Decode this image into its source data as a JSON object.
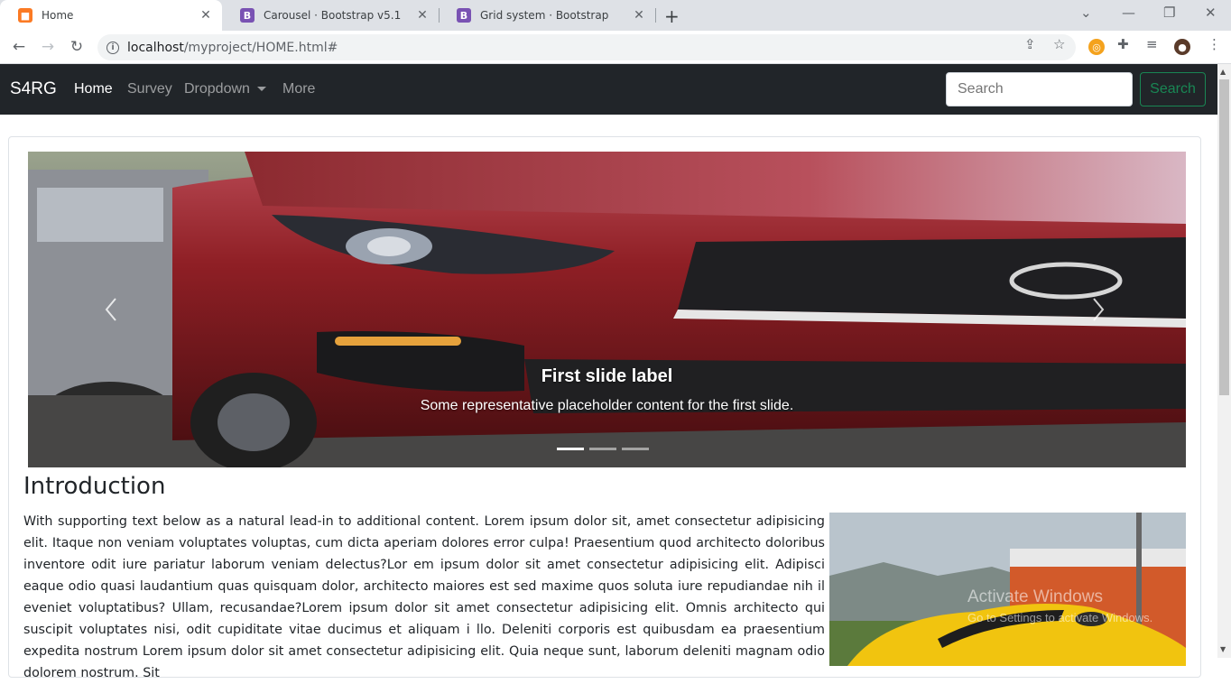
{
  "browser": {
    "tabs": [
      {
        "title": "Home",
        "favicon": "xampp-icon"
      },
      {
        "title": "Carousel · Bootstrap v5.1",
        "favicon": "bootstrap-icon"
      },
      {
        "title": "Grid system · Bootstrap",
        "favicon": "bootstrap-icon"
      }
    ],
    "url_host": "localhost",
    "url_path": "/myproject/HOME.html#"
  },
  "navbar": {
    "brand": "S4RG",
    "links": [
      "Home",
      "Survey",
      "Dropdown",
      "More"
    ],
    "search_placeholder": "Search",
    "search_button": "Search"
  },
  "carousel": {
    "slide_title": "First slide label",
    "slide_text": "Some representative placeholder content for the first slide.",
    "indicator_count": 3,
    "active_indicator": 0
  },
  "intro": {
    "heading": "Introduction",
    "text": "With supporting text below as a natural lead-in to additional content. Lorem ipsum dolor sit, amet consectetur adipisicing elit. Itaque non veniam voluptates voluptas, cum dicta aperiam dolores error culpa! Praesentium quod architecto doloribus inventore odit iure pariatur laborum veniam delectus?Lor em ipsum dolor sit amet consectetur adipisicing elit. Adipisci eaque odio quasi laudantium quas quisquam dolor, architecto maiores est sed maxime quos soluta iure repudiandae nih il eveniet voluptatibus? Ullam, recusandae?Lorem ipsum dolor sit amet consectetur adipisicing elit. Omnis architecto qui suscipit voluptates nisi, odit cupiditate vitae ducimus et aliquam i llo. Deleniti corporis est quibusdam ea praesentium expedita nostrum Lorem ipsum dolor sit amet consectetur adipisicing elit. Quia neque sunt, laborum deleniti magnam odio dolorem nostrum. Sit"
  },
  "watermark": {
    "line1": "Activate Windows",
    "line2": "Go to Settings to activate Windows."
  }
}
